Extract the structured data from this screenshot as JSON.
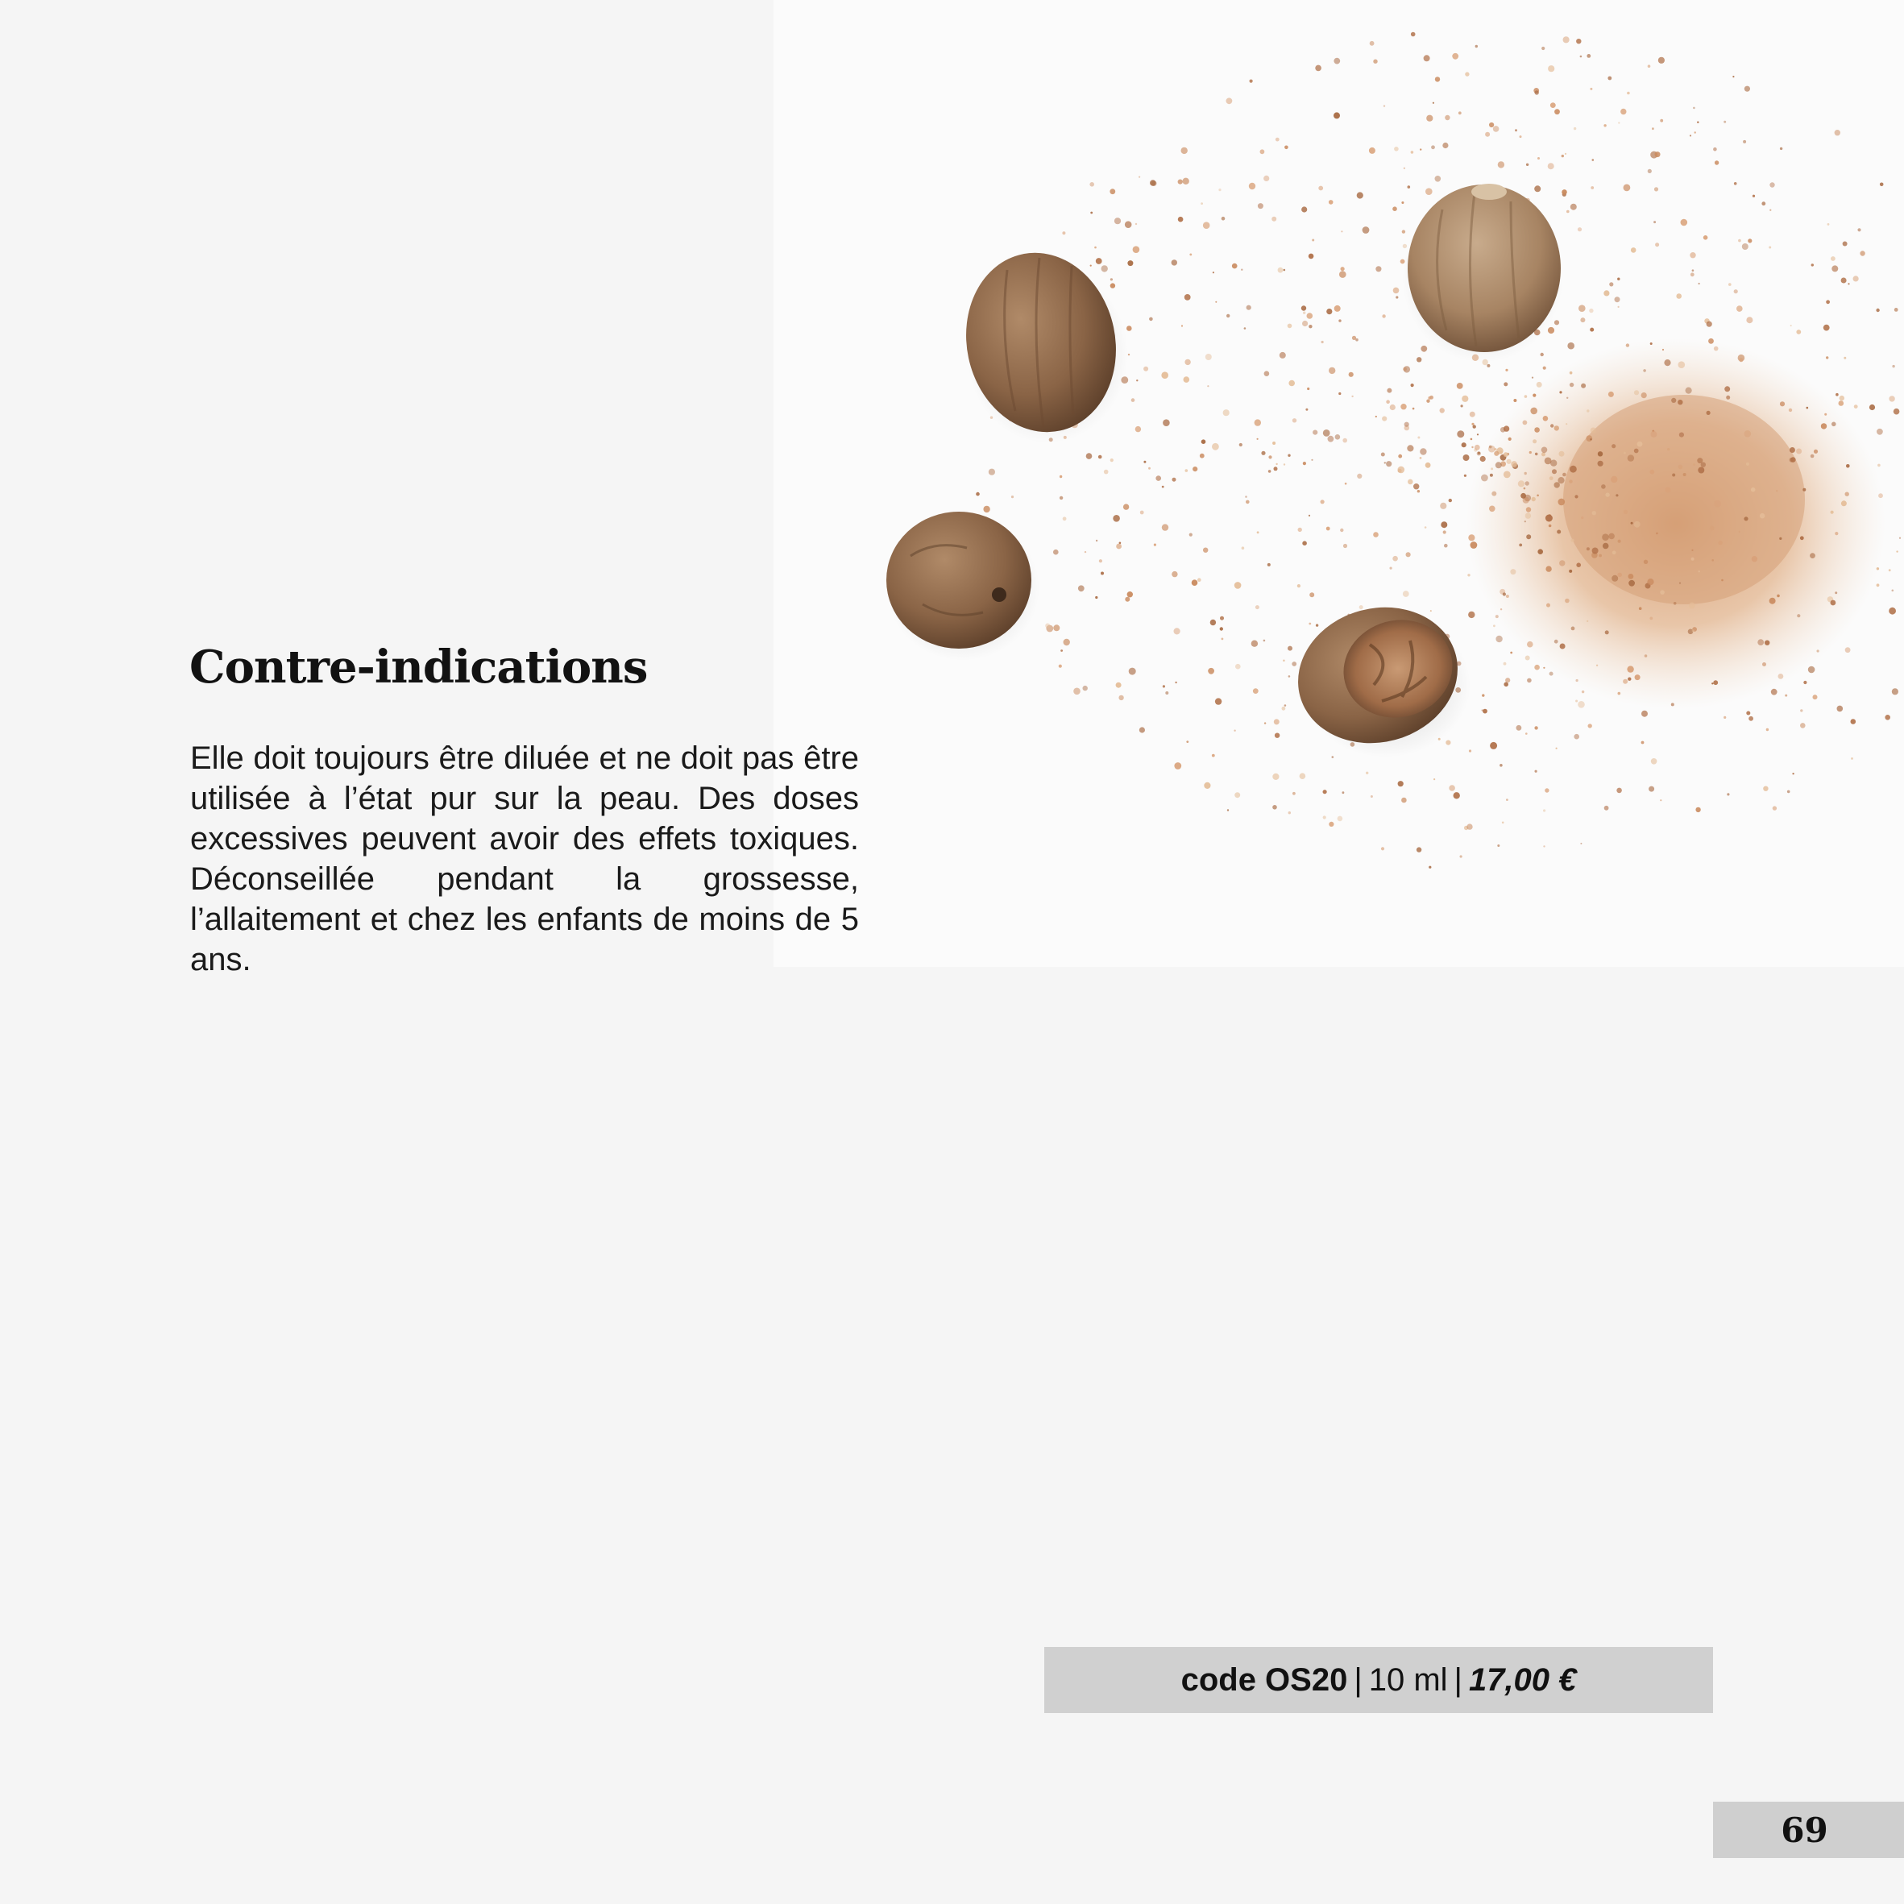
{
  "section": {
    "title": "Contre-indications",
    "body": "Elle doit toujours être diluée et ne doit pas être utilisée à l’état pur sur la peau. Des doses excessives peuvent avoir des effets toxiques. Déconseillée pendant la grossesse, l’allaitement et chez les enfants de moins de 5 ans."
  },
  "product": {
    "code": "code OS20",
    "separator": "|",
    "volume": "10 ml",
    "price": "17,00 €"
  },
  "page": {
    "number": "69"
  },
  "colors": {
    "background": "#f5f5f5",
    "bar": "#d0d0d0",
    "nut": "#8a6446",
    "powder": "#d9a27a"
  }
}
